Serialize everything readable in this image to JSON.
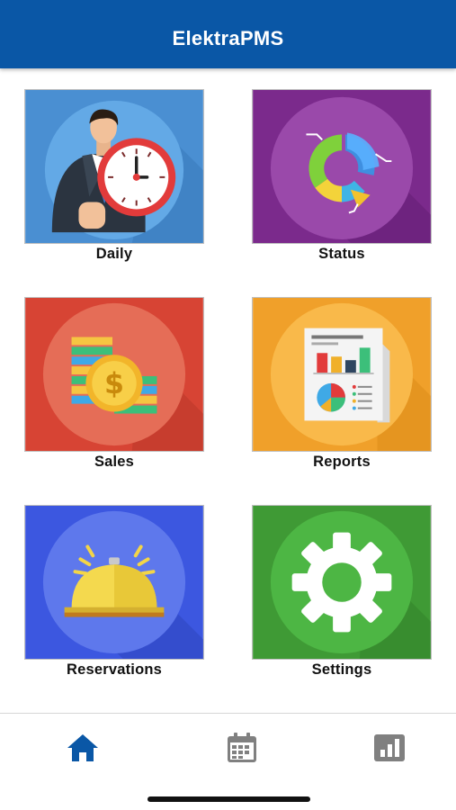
{
  "app": {
    "title": "ElektraPMS"
  },
  "tiles": [
    {
      "id": "daily",
      "label": "Daily",
      "icon": "businessman-clock-icon",
      "bg": "#4a8fd2",
      "circle": "#63a9e6"
    },
    {
      "id": "status",
      "label": "Status",
      "icon": "donut-chart-icon",
      "bg": "#7b2a8c",
      "circle": "#9a49aa"
    },
    {
      "id": "sales",
      "label": "Sales",
      "icon": "coins-dollar-icon",
      "bg": "#d74434",
      "circle": "#e56d57"
    },
    {
      "id": "reports",
      "label": "Reports",
      "icon": "report-document-icon",
      "bg": "#f0a02a",
      "circle": "#f9b94a"
    },
    {
      "id": "reservations",
      "label": "Reservations",
      "icon": "service-bell-icon",
      "bg": "#3c57e0",
      "circle": "#5e78ec"
    },
    {
      "id": "settings",
      "label": "Settings",
      "icon": "gear-icon",
      "bg": "#3f9a35",
      "circle": "#4db644"
    }
  ],
  "tab_bar": {
    "items": [
      {
        "icon": "home-icon",
        "active": true,
        "color": "#0a57a6"
      },
      {
        "icon": "calendar-icon",
        "active": false,
        "color": "#808080"
      },
      {
        "icon": "bar-chart-icon",
        "active": false,
        "color": "#808080"
      }
    ]
  }
}
